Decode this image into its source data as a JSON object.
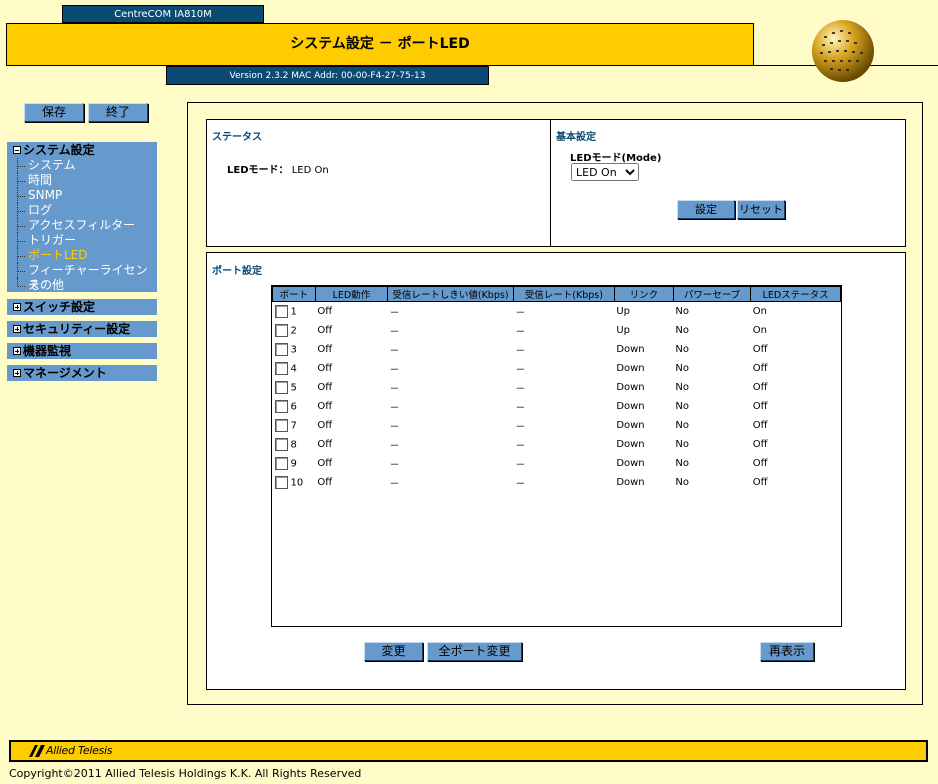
{
  "header": {
    "model": "CentreCOM IA810M",
    "title": "システム設定 － ポートLED",
    "version": "Version 2.3.2 MAC Addr: 00-00-F4-27-75-13"
  },
  "buttons": {
    "save": "保存",
    "exit": "終了"
  },
  "sidebar": {
    "sections": [
      {
        "label": "システム設定",
        "expanded": true,
        "items": [
          "システム",
          "時間",
          "SNMP",
          "ログ",
          "アクセスフィルター",
          "トリガー",
          "ポートLED",
          "フィーチャーライセンス",
          "その他"
        ],
        "active": "ポートLED"
      },
      {
        "label": "スイッチ設定",
        "expanded": false
      },
      {
        "label": "セキュリティー設定",
        "expanded": false
      },
      {
        "label": "機器監視",
        "expanded": false
      },
      {
        "label": "マネージメント",
        "expanded": false
      }
    ]
  },
  "status": {
    "title": "ステータス",
    "led_mode_label": "LEDモード：",
    "led_mode_value": "LED On"
  },
  "basic": {
    "title": "基本設定",
    "mode_label": "LEDモード(Mode)",
    "mode_value": "LED On",
    "set_button": "設定",
    "reset_button": "リセット"
  },
  "port_settings": {
    "title": "ポート設定",
    "columns": [
      "ポート",
      "LED動作",
      "受信レートしきい値(Kbps)",
      "受信レート(Kbps)",
      "リンク",
      "パワーセーブ",
      "LEDステータス"
    ],
    "rows": [
      [
        "1",
        "Off",
        "－",
        "－",
        "Up",
        "No",
        "On"
      ],
      [
        "2",
        "Off",
        "－",
        "－",
        "Up",
        "No",
        "On"
      ],
      [
        "3",
        "Off",
        "－",
        "－",
        "Down",
        "No",
        "Off"
      ],
      [
        "4",
        "Off",
        "－",
        "－",
        "Down",
        "No",
        "Off"
      ],
      [
        "5",
        "Off",
        "－",
        "－",
        "Down",
        "No",
        "Off"
      ],
      [
        "6",
        "Off",
        "－",
        "－",
        "Down",
        "No",
        "Off"
      ],
      [
        "7",
        "Off",
        "－",
        "－",
        "Down",
        "No",
        "Off"
      ],
      [
        "8",
        "Off",
        "－",
        "－",
        "Down",
        "No",
        "Off"
      ],
      [
        "9",
        "Off",
        "－",
        "－",
        "Down",
        "No",
        "Off"
      ],
      [
        "10",
        "Off",
        "－",
        "－",
        "Down",
        "No",
        "Off"
      ]
    ],
    "change_button": "変更",
    "change_all_button": "全ポート変更",
    "refresh_button": "再表示"
  },
  "footer": {
    "brand": "Allied Telesis",
    "copyright": "Copyright©2011 Allied Telesis Holdings K.K. All Rights Reserved"
  },
  "colors": {
    "navy": "#0b4a73",
    "gold": "#ffcc00",
    "blue": "#6699cc",
    "cream": "#fffcc8"
  }
}
